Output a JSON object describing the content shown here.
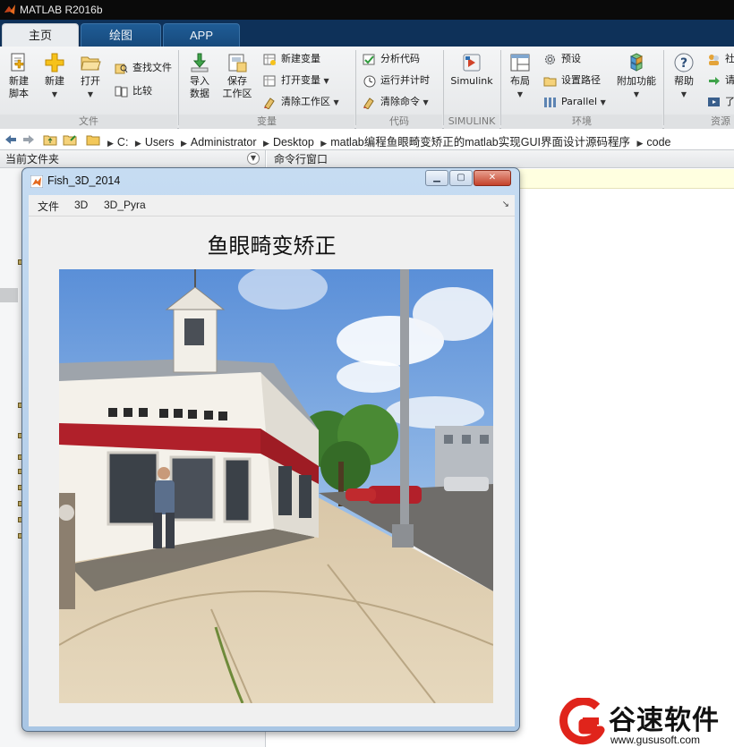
{
  "window": {
    "title": "MATLAB R2016b"
  },
  "tabs": [
    {
      "label": "主页",
      "active": true
    },
    {
      "label": "绘图",
      "active": false
    },
    {
      "label": "APP",
      "active": false
    }
  ],
  "ribbon": {
    "new_script": "新建\n脚本",
    "new": "新建",
    "open": "打开",
    "find_files": "查找文件",
    "compare": "比较",
    "import_data": "导入\n数据",
    "save_workspace": "保存\n工作区",
    "new_variable": "新建变量",
    "open_variable": "打开变量",
    "clear_workspace": "清除工作区",
    "analyze_code": "分析代码",
    "run_and_time": "运行并计时",
    "clear_commands": "清除命令",
    "simulink": "Simulink",
    "layout": "布局",
    "preferences": "预设",
    "set_path": "设置路径",
    "parallel": "Parallel",
    "add_ons": "附加功能",
    "help": "帮助",
    "community": "社",
    "request": "请",
    "learn": "了",
    "groups": {
      "file": "文件",
      "variable": "变量",
      "code": "代码",
      "simulink": "SIMULINK",
      "environment": "环境",
      "resources": "资源"
    }
  },
  "address": {
    "path": [
      "C:",
      "Users",
      "Administrator",
      "Desktop",
      "matlab编程鱼眼畸变矫正的matlab实现GUI界面设计源码程序",
      "code"
    ]
  },
  "panels": {
    "current_folder": "当前文件夹",
    "command_window": "命令行窗口"
  },
  "figure": {
    "title": "Fish_3D_2014",
    "menu": [
      "文件",
      "3D",
      "3D_Pyra"
    ],
    "heading": "鱼眼畸变矫正"
  },
  "colors": {
    "accent": "#0e3159",
    "tab_blue": "#1f5c96",
    "watermark_red": "#e0241b"
  },
  "watermark": {
    "name": "谷速软件",
    "url": "www.gususoft.com"
  }
}
